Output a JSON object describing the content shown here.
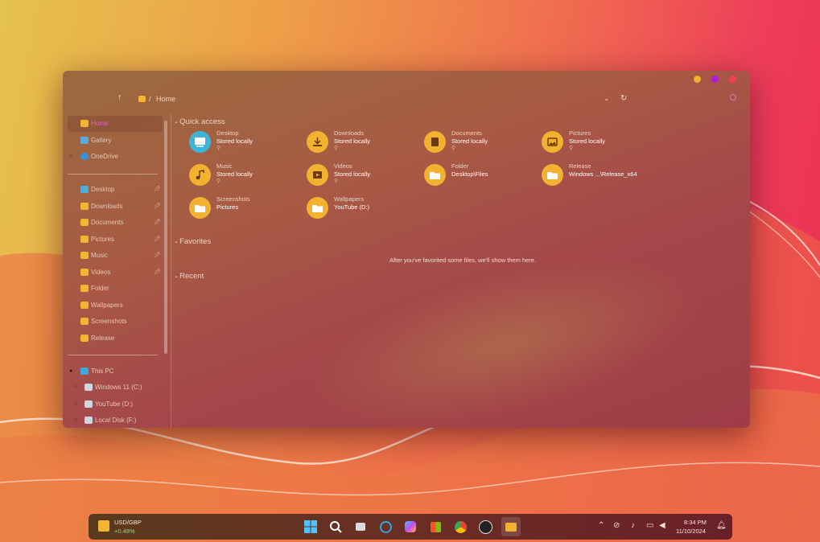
{
  "toolbar": {
    "breadcrumb_sep": "/",
    "location": "Home"
  },
  "sidebar": {
    "top": [
      {
        "label": "Home",
        "icon": "home-icon"
      },
      {
        "label": "Gallery",
        "icon": "gallery-icon"
      },
      {
        "label": "OneDrive",
        "icon": "cloud-icon"
      }
    ],
    "pinned": [
      {
        "label": "Desktop",
        "icon": "desktop-folder-icon"
      },
      {
        "label": "Downloads",
        "icon": "downloads-folder-icon"
      },
      {
        "label": "Documents",
        "icon": "documents-folder-icon"
      },
      {
        "label": "Pictures",
        "icon": "pictures-folder-icon"
      },
      {
        "label": "Music",
        "icon": "music-folder-icon"
      },
      {
        "label": "Videos",
        "icon": "videos-folder-icon"
      },
      {
        "label": "Folder",
        "icon": "folder-icon"
      },
      {
        "label": "Wallpapers",
        "icon": "folder-icon"
      },
      {
        "label": "Screenshots",
        "icon": "folder-icon"
      },
      {
        "label": "Release",
        "icon": "folder-icon"
      }
    ],
    "devices": [
      {
        "label": "This PC",
        "icon": "pc-icon"
      },
      {
        "label": "Windows 11 (C:)",
        "icon": "drive-icon"
      },
      {
        "label": "YouTube (D:)",
        "icon": "drive-icon"
      },
      {
        "label": "Local Disk (F:)",
        "icon": "drive-icon"
      }
    ]
  },
  "main": {
    "quick_access_label": "Quick access",
    "favorites_label": "Favorites",
    "recent_label": "Recent",
    "favorites_empty": "After you've favorited some files, we'll show them here.",
    "tiles": [
      {
        "name": "Desktop",
        "sub": "Stored locally",
        "icon": "desktop-icon",
        "pinned": true
      },
      {
        "name": "Downloads",
        "sub": "Stored locally",
        "icon": "download-icon",
        "pinned": true
      },
      {
        "name": "Documents",
        "sub": "Stored locally",
        "icon": "document-icon",
        "pinned": true
      },
      {
        "name": "Pictures",
        "sub": "Stored locally",
        "icon": "picture-icon",
        "pinned": true
      },
      {
        "name": "Music",
        "sub": "Stored locally",
        "icon": "music-icon",
        "pinned": true
      },
      {
        "name": "Videos",
        "sub": "Stored locally",
        "icon": "video-icon",
        "pinned": true
      },
      {
        "name": "Folder",
        "sub": "Desktop\\Files",
        "icon": "folder-icon",
        "pinned": false
      },
      {
        "name": "Release",
        "sub": "Windows ...\\Release_x64",
        "icon": "folder-icon",
        "pinned": false
      },
      {
        "name": "Screenshots",
        "sub": "Pictures",
        "icon": "folder-icon",
        "pinned": false
      },
      {
        "name": "Wallpapers",
        "sub": "YouTube (D:)",
        "icon": "folder-icon",
        "pinned": false
      }
    ]
  },
  "taskbar": {
    "widget_pair": "USD/GBP",
    "widget_change": "+0.48%",
    "time": "8:34 PM",
    "date": "11/10/2024"
  },
  "colors": {
    "folder": "#f3b130",
    "close": "#f1404e",
    "min": "#f2b12d",
    "max": "#b31bd0",
    "widget_change": "#7fe07a"
  }
}
